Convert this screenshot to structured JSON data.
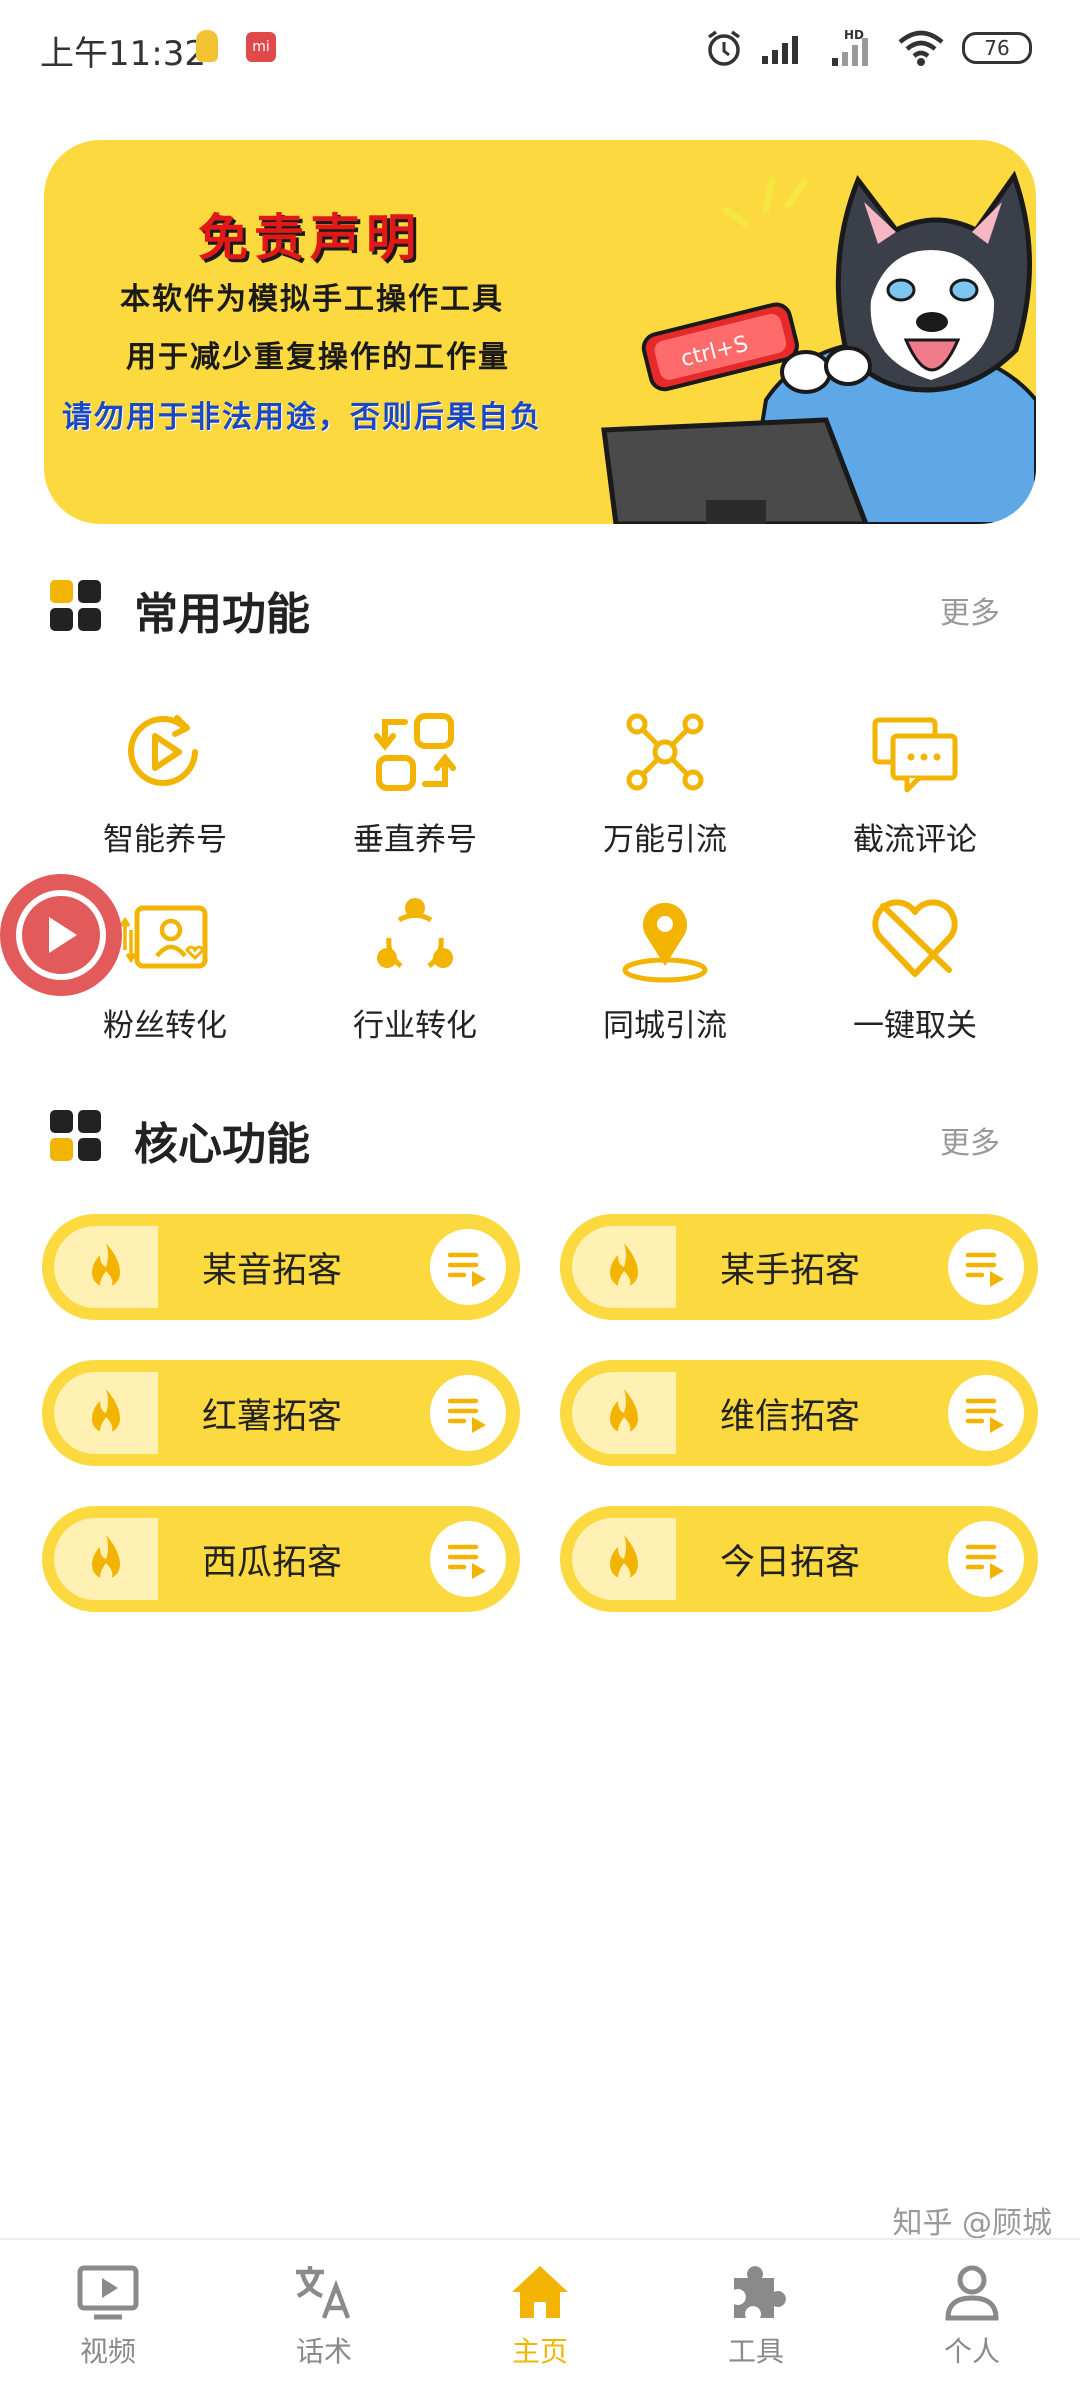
{
  "status_bar": {
    "time": "上午11:32",
    "mi_badge": "mi",
    "network": "HD",
    "battery": "76"
  },
  "banner": {
    "title": "免责声明",
    "line1": "本软件为模拟手工操作工具",
    "line2": "用于减少重复操作的工作量",
    "line3": "请勿用于非法用途，否则后果自负",
    "sticker_text": "ctrl+S"
  },
  "common_section": {
    "title": "常用功能",
    "more": "更多",
    "items": [
      {
        "label": "智能养号",
        "icon": "play-cycle-icon"
      },
      {
        "label": "垂直养号",
        "icon": "swap-squares-icon"
      },
      {
        "label": "万能引流",
        "icon": "network-nodes-icon"
      },
      {
        "label": "截流评论",
        "icon": "comment-bubbles-icon"
      },
      {
        "label": "粉丝转化",
        "icon": "fan-card-icon"
      },
      {
        "label": "行业转化",
        "icon": "three-dots-cycle-icon"
      },
      {
        "label": "同城引流",
        "icon": "location-pin-icon"
      },
      {
        "label": "一键取关",
        "icon": "broken-heart-icon"
      }
    ]
  },
  "core_section": {
    "title": "核心功能",
    "more": "更多",
    "items": [
      {
        "label": "某音拓客"
      },
      {
        "label": "某手拓客"
      },
      {
        "label": "红薯拓客"
      },
      {
        "label": "维信拓客"
      },
      {
        "label": "西瓜拓客"
      },
      {
        "label": "今日拓客"
      }
    ]
  },
  "bottom_nav": {
    "items": [
      {
        "label": "视频",
        "icon": "tv-play-icon",
        "active": false
      },
      {
        "label": "话术",
        "icon": "translate-icon",
        "active": false
      },
      {
        "label": "主页",
        "icon": "home-icon",
        "active": true
      },
      {
        "label": "工具",
        "icon": "puzzle-icon",
        "active": false
      },
      {
        "label": "个人",
        "icon": "person-icon",
        "active": false
      }
    ]
  },
  "watermark": "知乎 @顾城",
  "colors": {
    "accent": "#fcd93e",
    "icon": "#f2b400",
    "active_nav": "#f2b400",
    "float_button": "#e35a5a"
  }
}
